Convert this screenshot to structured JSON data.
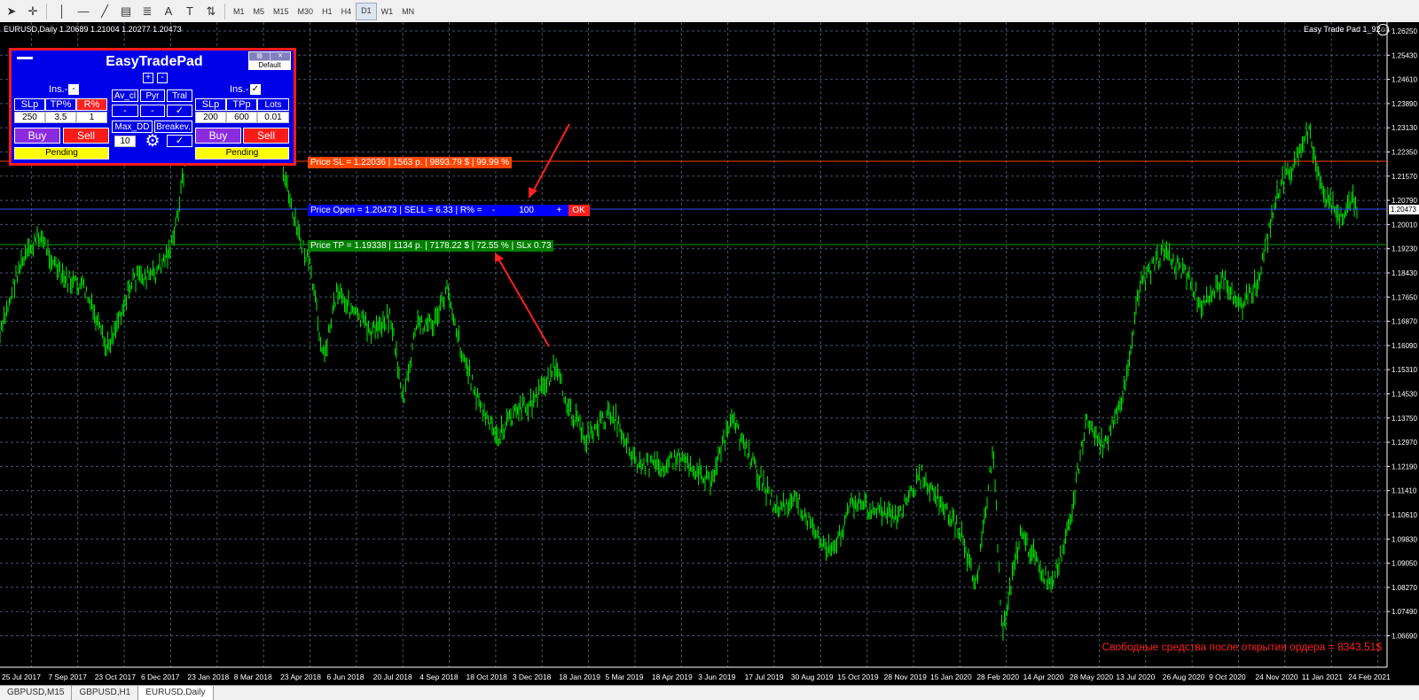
{
  "toolbar": {
    "timeframes": [
      "M1",
      "M5",
      "M15",
      "M30",
      "H1",
      "H4",
      "D1",
      "W1",
      "MN"
    ],
    "active_timeframe": "D1"
  },
  "chart": {
    "symbol_info": "EURUSD,Daily  1.20689 1.21004 1.20277 1.20473",
    "ea_label": "Easy Trade Pad 1_92",
    "price_axis": [
      "1.26250",
      "1.25430",
      "1.24610",
      "1.23890",
      "1.23130",
      "1.22350",
      "1.21570",
      "1.20790",
      "1.20010",
      "1.19230",
      "1.18430",
      "1.17650",
      "1.16870",
      "1.16090",
      "1.15310",
      "1.14530",
      "1.13750",
      "1.12970",
      "1.12190",
      "1.11410",
      "1.10610",
      "1.09830",
      "1.09050",
      "1.08270",
      "1.07490",
      "1.06690"
    ],
    "current_price": "1.20473",
    "date_axis": [
      "25 Jul 2017",
      "7 Sep 2017",
      "23 Oct 2017",
      "6 Dec 2017",
      "23 Jan 2018",
      "8 Mar 2018",
      "23 Apr 2018",
      "6 Jun 2018",
      "20 Jul 2018",
      "4 Sep 2018",
      "18 Oct 2018",
      "3 Dec 2018",
      "18 Jan 2019",
      "5 Mar 2019",
      "18 Apr 2019",
      "3 Jun 2019",
      "17 Jul 2019",
      "30 Aug 2019",
      "15 Oct 2019",
      "28 Nov 2019",
      "15 Jan 2020",
      "28 Feb 2020",
      "14 Apr 2020",
      "28 May 2020",
      "13 Jul 2020",
      "26 Aug 2020",
      "9 Oct 2020",
      "24 Nov 2020",
      "11 Jan 2021",
      "24 Feb 2021"
    ],
    "free_margin_text": "Свободные средства после открытия ордера = 8343.51$",
    "colors": {
      "background": "#000000",
      "candles": "#00d800",
      "grid": "#46566e",
      "sl": "#ff4500",
      "open": "#0000ff",
      "tp": "#008000"
    }
  },
  "lines": {
    "sl_label": "Price SL = 1.22036 | 1563 p. | 9893.79 $ | 99.99 %",
    "open_label": "Price Open = 1.20473 | SELL = 6.33 | R% =",
    "open_minus": "-",
    "open_value": "100",
    "open_plus": "+",
    "open_ok": "OK",
    "tp_label": "Price TP = 1.19338 | 1134 p. | 7178.22 $ | 72.55 % | SLx 0.73"
  },
  "pad": {
    "title": "EasyTradePad",
    "minimize": "—",
    "plus": "+",
    "minus": "-",
    "preset": "Default",
    "left": {
      "ins_label": "Ins.-",
      "ins_state": "-",
      "headers": [
        "SLp",
        "TP%",
        "R%"
      ],
      "values": [
        "250",
        "3.5",
        "1"
      ],
      "buy": "Buy",
      "sell": "Sell",
      "pending": "Pending"
    },
    "middle": {
      "headers": [
        "Av_cl",
        "Pyr",
        "Tral"
      ],
      "states": [
        "-",
        "-",
        "✓"
      ],
      "maxdd_label": "Max_DD",
      "breakeven_label": "Breakev.",
      "maxdd_value": "10",
      "breakeven_state": "✓"
    },
    "right": {
      "ins_label": "Ins.-",
      "ins_state": "✓",
      "headers": [
        "SLp",
        "TPp",
        "Lots"
      ],
      "values": [
        "200",
        "600",
        "0.01"
      ],
      "buy": "Buy",
      "sell": "Sell",
      "pending": "Pending"
    }
  },
  "tabs": [
    "GBPUSD,M15",
    "GBPUSD,H1",
    "EURUSD,Daily"
  ],
  "active_tab": "EURUSD,Daily"
}
